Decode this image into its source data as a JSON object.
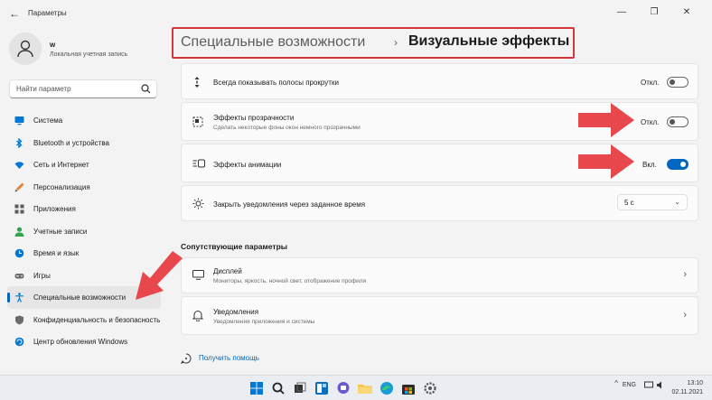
{
  "window": {
    "title": "Параметры",
    "minimize": "—",
    "maximize": "❐",
    "close": "✕"
  },
  "user": {
    "name": "w",
    "account_type": "Локальная учетная запись"
  },
  "search": {
    "placeholder": "Найти параметр"
  },
  "sidebar": {
    "items": [
      {
        "label": "Система",
        "icon": "monitor-icon",
        "color": "#0078d4"
      },
      {
        "label": "Bluetooth и устройства",
        "icon": "bluetooth-icon",
        "color": "#0078d4"
      },
      {
        "label": "Сеть и Интернет",
        "icon": "network-icon",
        "color": "#0078d4"
      },
      {
        "label": "Персонализация",
        "icon": "brush-icon",
        "color": "#e3813a"
      },
      {
        "label": "Приложения",
        "icon": "apps-icon",
        "color": "#5a5a5a"
      },
      {
        "label": "Учетные записи",
        "icon": "person-icon",
        "color": "#2da44e"
      },
      {
        "label": "Время и язык",
        "icon": "globe-clock-icon",
        "color": "#0078d4"
      },
      {
        "label": "Игры",
        "icon": "gamepad-icon",
        "color": "#6b6b6b"
      },
      {
        "label": "Специальные возможности",
        "icon": "accessibility-icon",
        "color": "#0078d4",
        "active": true
      },
      {
        "label": "Конфиденциальность и безопасность",
        "icon": "shield-icon",
        "color": "#6b6b6b"
      },
      {
        "label": "Центр обновления Windows",
        "icon": "update-icon",
        "color": "#0078d4"
      }
    ]
  },
  "breadcrumb": {
    "parent": "Специальные возможности",
    "separator": "›",
    "current": "Визуальные эффекты"
  },
  "settings": {
    "scrollbars": {
      "title": "Всегда показывать полосы прокрутки",
      "state": "Откл.",
      "on": false
    },
    "transparency": {
      "title": "Эффекты прозрачности",
      "subtitle": "Сделать некоторые фоны окон немного прозрачными",
      "state": "Откл.",
      "on": false
    },
    "animation": {
      "title": "Эффекты анимации",
      "state": "Вкл.",
      "on": true
    },
    "notifications": {
      "title": "Закрыть уведомления через заданное время",
      "value": "5 с"
    }
  },
  "related": {
    "title": "Сопутствующие параметры",
    "display": {
      "title": "Дисплей",
      "subtitle": "Мониторы, яркость, ночной свет, отображение профиля"
    },
    "notifications": {
      "title": "Уведомления",
      "subtitle": "Уведомления приложения и системы"
    }
  },
  "help": {
    "label": "Получить помощь"
  },
  "taskbar": {
    "language": "ENG",
    "time": "13:10",
    "date": "02.11.2021",
    "tray_arrow": "^"
  },
  "colors": {
    "accent": "#0067c0",
    "highlight_red": "#d2363c",
    "arrow_red": "#e8474c"
  }
}
